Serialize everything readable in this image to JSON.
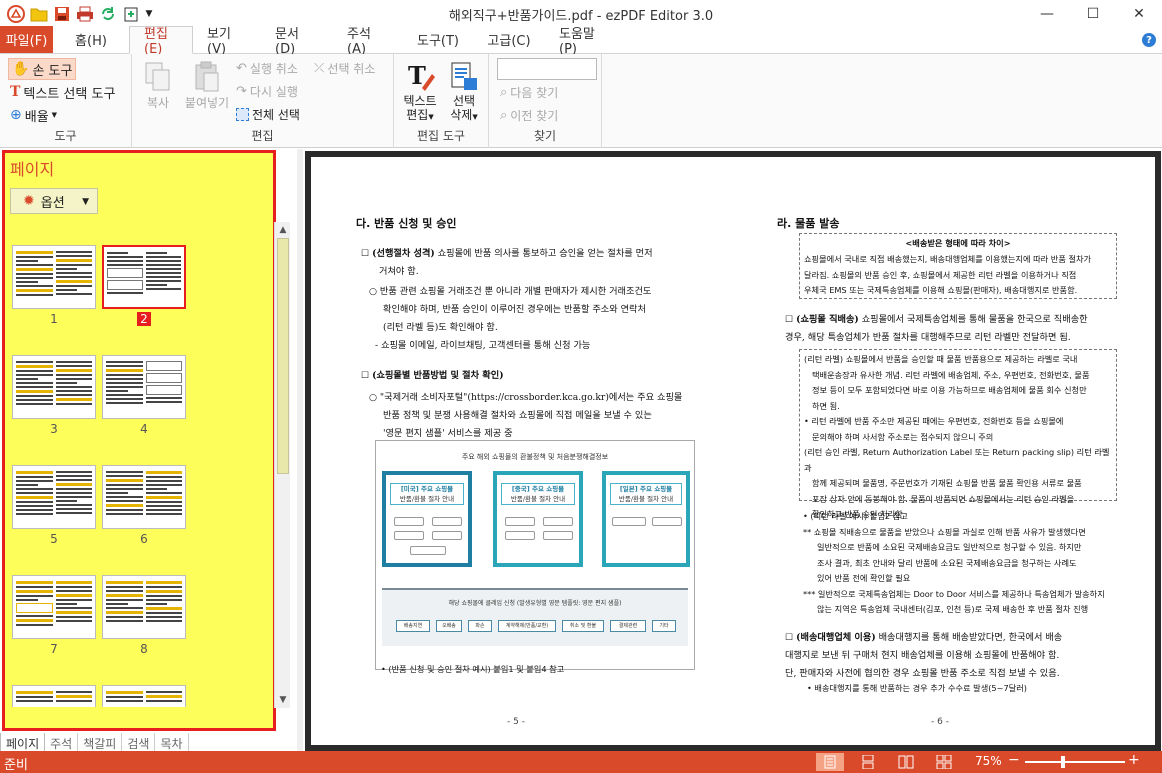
{
  "window": {
    "title": "해외직구+반품가이드.pdf - ezPDF Editor 3.0",
    "accent": "#d94a2b"
  },
  "quick_access": [
    "app-logo-icon",
    "open-folder-icon",
    "save-icon",
    "print-icon",
    "refresh-icon",
    "new-document-icon",
    "dropdown-icon"
  ],
  "menu": {
    "file": "파일(F)",
    "tabs": [
      "홈(H)",
      "편집(E)",
      "보기(V)",
      "문서(D)",
      "주석(A)",
      "도구(T)",
      "고급(C)",
      "도움말(P)"
    ],
    "active_tab": "편집(E)"
  },
  "ribbon": {
    "tools": {
      "label": "도구",
      "hand": "손 도구",
      "text_select": "텍스트 선택 도구",
      "zoom": "배율"
    },
    "edit": {
      "label": "편집",
      "copy": "복사",
      "paste": "붙여넣기",
      "undo": "실행 취소",
      "redo": "다시 실행",
      "deselect": "선택 취소",
      "select_all": "전체 선택"
    },
    "edit_tools": {
      "label": "편집 도구",
      "text_edit": [
        "텍스트",
        "편집"
      ],
      "select_delete": [
        "선택",
        "삭제"
      ]
    },
    "find": {
      "label": "찾기",
      "input_value": "",
      "next": "다음 찾기",
      "prev": "이전 찾기"
    }
  },
  "left_panel": {
    "title": "페이지",
    "options": "옵션",
    "thumbnails": [
      "1",
      "2",
      "3",
      "4",
      "5",
      "6",
      "7",
      "8"
    ],
    "selected_page": "2",
    "tabs": [
      "페이지",
      "주석",
      "책갈피",
      "검색",
      "목차"
    ],
    "active_tab": "페이지"
  },
  "document": {
    "left": {
      "heading": "다. 반품 신청 및 승인",
      "p1_title": "(선행절차 성격)",
      "p1_text_l1": " 쇼핑몰에 반품 의사를 통보하고 승인을 얻는 절차를 먼저",
      "p1_text_l2": "거쳐야 함.",
      "p2_l1": "○ 반품 관련 쇼핑몰 거래조건 뿐 아니라 개별 판매자가 제시한 거래조건도",
      "p2_l2": "확인해야 하며, 반품 승인이 이루어진 경우에는 반품할 주소와 연락처",
      "p2_l3": "(리턴 라벨 등)도 확인해야 함.",
      "p2_l4": "- 쇼핑몰 이메일, 라이브채팅, 고객센터를 통해 신청 가능",
      "p3_title": "(쇼핑몰별 반품방법 및 절차 확인)",
      "p4_l1": "○ \"국제거래 소비자포털\"(https://crossborder.kca.go.kr)에서는 주요 쇼핑몰",
      "p4_l2": "반품 정책 및 분쟁 사용해결 절차와 쇼핑몰에 직접 메일을 보낼 수 있는",
      "p4_l3": "'영문 편지 샘플' 서비스를 제공 중",
      "fig_caption": "주요 해외 쇼핑몰의 환불정책 및 처음분쟁해결정보",
      "card1": [
        "[미국] 주요 쇼핑몰",
        "반품/환불 절차 안내"
      ],
      "card2": [
        "[중국] 주요 쇼핑몰",
        "반품/환불 절차 안내"
      ],
      "card3": [
        "[일본] 주요 쇼핑몰",
        "반품/환불 절차 안내"
      ],
      "band_title": "해당 쇼핑몰에 클레임 신청 (발생유형별 영문 템플릿: 영문 편지 샘플)",
      "band_items": [
        "배송지연",
        "오배송",
        "파손",
        "계약해제(반품/교환)",
        "취소 및 환불",
        "결제관련",
        "기타"
      ],
      "note": "• (반품 신청 및 승인 절차 예시) 붙임1 및 붙임4 참고",
      "page_no": "- 5 -"
    },
    "right": {
      "heading": "라. 물품 발송",
      "box_title": "<배송받은 형태에 따라 차이>",
      "box_l1": "쇼핑몰에서 국내로 직접 배송했는지, 배송대행업체를 이용했는지에 따라 반품 절차가",
      "box_l2": "달라짐. 쇼핑몰의 반품 승인 후, 쇼핑몰에서 제공한 리턴 라벨을 이용하거나 직접",
      "box_l3": "우체국 EMS 또는 국제특송업체를 이용해 쇼핑몰(판매자), 배송대행지로 반품함.",
      "p1_title": "(쇼핑몰 직배송)",
      "p1_l1": " 쇼핑몰에서 국제특송업체를 통해 물품을 한국으로 직배송한",
      "p1_l2": "경우, 해당 특송업체가 반품 절차를 대행해주므로 리턴 라벨만 전달하면 됨.",
      "r1": "(리턴 라벨) 쇼핑몰에서 반품을 승인할 때 물품 반품용으로 제공하는 라벨로 국내",
      "r2": "택배운송장과 유사한 개념. 리턴 라벨에 배송업체, 주소, 우편번호, 전화번호, 물품",
      "r3": "정보 등이 모두 포함되었다면 바로 이용 가능하므로 배송업체에 물품 회수 신청만",
      "r4": "하면 됨.",
      "r5": "• 리턴 라벨에 반품 주소만 제공된 때에는 우편번호, 전화번호 등을 쇼핑몰에",
      "r6": "문의해야 하며 사서함 주소로는 접수되지 않으니 주의",
      "r7": "(리턴 승인 라벨, Return Authorization Label 또는 Return packing slip) 리턴 라벨과",
      "r8": "함께 제공되며 물품명, 주문번호가 기재된 쇼핑몰 반품 물품 확인용 서류로 물품",
      "r9": "포장 상자 안에 동봉해야 함. 물품이 반품되면 쇼핑몰에서는 리턴 승인 라벨을",
      "r10": "확인하고 반품 승인 처리함.",
      "n1": "• (리턴 라벨 예시) 붙임2 참고",
      "n2": "** 쇼핑몰 직배송으로 물품을 받았으나 쇼핑몰 과실로 인해 반품 사유가 발생했다면",
      "n3": "일반적으로 반품에 소요된 국제배송요금도 일반적으로 청구할 수 있음. 하지만",
      "n4": "조사 결과, 최초 안내와 달리 반품에 소요된 국제배송요금을 청구하는 사례도",
      "n5": "있어 반품 전에 확인할 필요",
      "n6": "*** 일반적으로 국제특송업체는 Door to Door 서비스를 제공하나 특송업체가 발송하지",
      "n7": "않는 지역은 특송업체 국내센터(김포, 인천 등)로 국제 배송한 후 반품 절차 진행",
      "p2_title": "(배송대행업체 이용)",
      "p2_l1": " 배송대행지를 통해 배송받았다면, 한국에서 배송",
      "p2_l2": "대행지로 보낸 뒤 구매처 현지 배송업체를 이용해 쇼핑몰에 반품해야 함.",
      "p2_l3": "단, 판매자와 사전에 협의한 경우 쇼핑몰 반품 주소로 직접 보낼 수 있음.",
      "p2_l4": "• 배송대행지를 통해 반품하는 경우 추가 수수료 발생(5~7달러)",
      "page_no": "- 6 -"
    }
  },
  "status": {
    "text": "준비",
    "zoom": "75%",
    "view_modes": [
      "single-page-icon",
      "continuous-icon",
      "two-page-icon",
      "two-page-continuous-icon"
    ]
  }
}
